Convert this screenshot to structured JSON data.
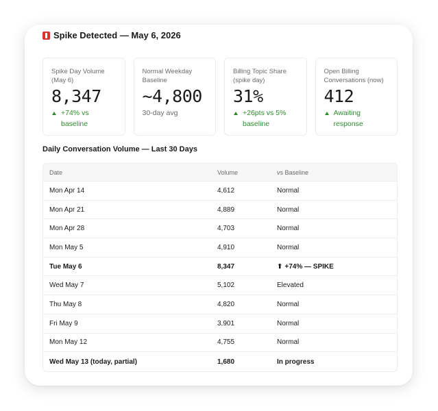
{
  "header": {
    "title": "Spike Detected — May 6, 2026",
    "icon": "alert-icon",
    "icon_color": "#d8342c"
  },
  "stats": [
    {
      "label": "Spike Day Volume (May 6)",
      "value": "8,347",
      "sub": "+74% vs baseline",
      "trend": "up"
    },
    {
      "label": "Normal Weekday Baseline",
      "value": "~4,800",
      "sub": "30-day avg",
      "trend": "none"
    },
    {
      "label": "Billing Topic Share (spike day)",
      "value": "31%",
      "sub": "+26pts vs 5% baseline",
      "trend": "up"
    },
    {
      "label": "Open Billing Conversations (now)",
      "value": "412",
      "sub": "Awaiting response",
      "trend": "up"
    }
  ],
  "section_title": "Daily Conversation Volume — Last 30 Days",
  "table": {
    "columns": [
      "Date",
      "Volume",
      "vs Baseline"
    ],
    "rows": [
      {
        "date": "Mon Apr 14",
        "volume": "4,612",
        "status": "Normal",
        "bold": false
      },
      {
        "date": "Mon Apr 21",
        "volume": "4,889",
        "status": "Normal",
        "bold": false
      },
      {
        "date": "Mon Apr 28",
        "volume": "4,703",
        "status": "Normal",
        "bold": false
      },
      {
        "date": "Mon May 5",
        "volume": "4,910",
        "status": "Normal",
        "bold": false
      },
      {
        "date": "Tue May 6",
        "volume": "8,347",
        "status": "+74% — SPIKE",
        "bold": true,
        "arrow": "⬆"
      },
      {
        "date": "Wed May 7",
        "volume": "5,102",
        "status": "Elevated",
        "bold": false
      },
      {
        "date": "Thu May 8",
        "volume": "4,820",
        "status": "Normal",
        "bold": false
      },
      {
        "date": "Fri May 9",
        "volume": "3,901",
        "status": "Normal",
        "bold": false
      },
      {
        "date": "Mon May 12",
        "volume": "4,755",
        "status": "Normal",
        "bold": false
      },
      {
        "date": "Wed May 13 (today, partial)",
        "volume": "1,680",
        "status": "In progress",
        "bold": true
      }
    ]
  },
  "colors": {
    "positive": "#2f8a2f",
    "alert": "#d8342c",
    "header_bg": "#f6f6f6"
  }
}
